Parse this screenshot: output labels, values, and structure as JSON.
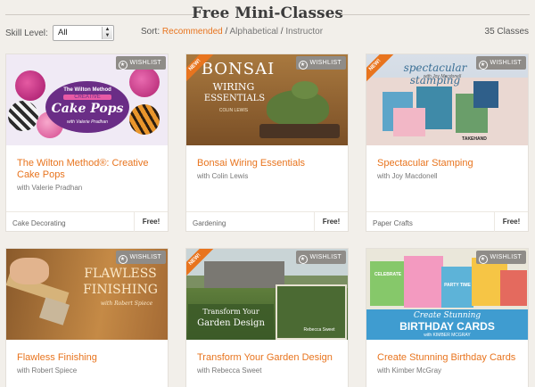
{
  "page": {
    "title": "Free Mini-Classes"
  },
  "toolbar": {
    "skill_label": "Skill Level:",
    "skill_value": "All",
    "sort_label": "Sort:",
    "sort_recommended": "Recommended",
    "sort_sep1": "/",
    "sort_alphabetical": "Alphabetical",
    "sort_sep2": "/",
    "sort_instructor": "Instructor",
    "count": "35 Classes"
  },
  "wishlist_label": "WISHLIST",
  "new_badge": "NEW!",
  "cards": [
    {
      "title": "The Wilton Method®: Creative Cake Pops",
      "instructor": "with Valerie Pradhan",
      "category": "Cake Decorating",
      "price": "Free!",
      "is_new": false,
      "img_text": {
        "l1": "The Wilton Method",
        "l2": "CREATIVE",
        "l3": "Cake Pops",
        "l4": "with Valerie Pradhan"
      }
    },
    {
      "title": "Bonsai Wiring Essentials",
      "instructor": "with Colin Lewis",
      "category": "Gardening",
      "price": "Free!",
      "is_new": true,
      "img_text": {
        "l1": "BONSAI",
        "l2": "WIRING",
        "l3": "ESSENTIALS",
        "l4": "COLIN LEWIS"
      }
    },
    {
      "title": "Spectacular Stamping",
      "instructor": "with Joy Macdonell",
      "category": "Paper Crafts",
      "price": "Free!",
      "is_new": true,
      "img_text": {
        "l1": "spectacular stamping",
        "l2": "with Joy Macdonell",
        "l3": "TAKEHAND",
        "l4": ""
      }
    },
    {
      "title": "Flawless Finishing",
      "instructor": "with Robert Spiece",
      "category": "",
      "price": "",
      "is_new": false,
      "img_text": {
        "l1": "FLAWLESS",
        "l2": "FINISHING",
        "l3": "with Robert Spiece",
        "l4": ""
      }
    },
    {
      "title": "Transform Your Garden Design",
      "instructor": "with Rebecca Sweet",
      "category": "",
      "price": "",
      "is_new": true,
      "img_text": {
        "l1": "Transform Your",
        "l2": "Garden Design",
        "l3": "Rebecca Sweet",
        "l4": ""
      }
    },
    {
      "title": "Create Stunning Birthday Cards",
      "instructor": "with Kimber McGray",
      "category": "",
      "price": "",
      "is_new": false,
      "img_text": {
        "l1": "Create Stunning",
        "l2": "BIRTHDAY CARDS",
        "l3": "with KIMBER MCGRAY",
        "l4": "CELEBRATE",
        "l5": "PARTY TIME"
      }
    }
  ],
  "colors": {
    "accent": "#e8741e",
    "background": "#f2efea",
    "wishlist_bg": "#8f8c88"
  }
}
